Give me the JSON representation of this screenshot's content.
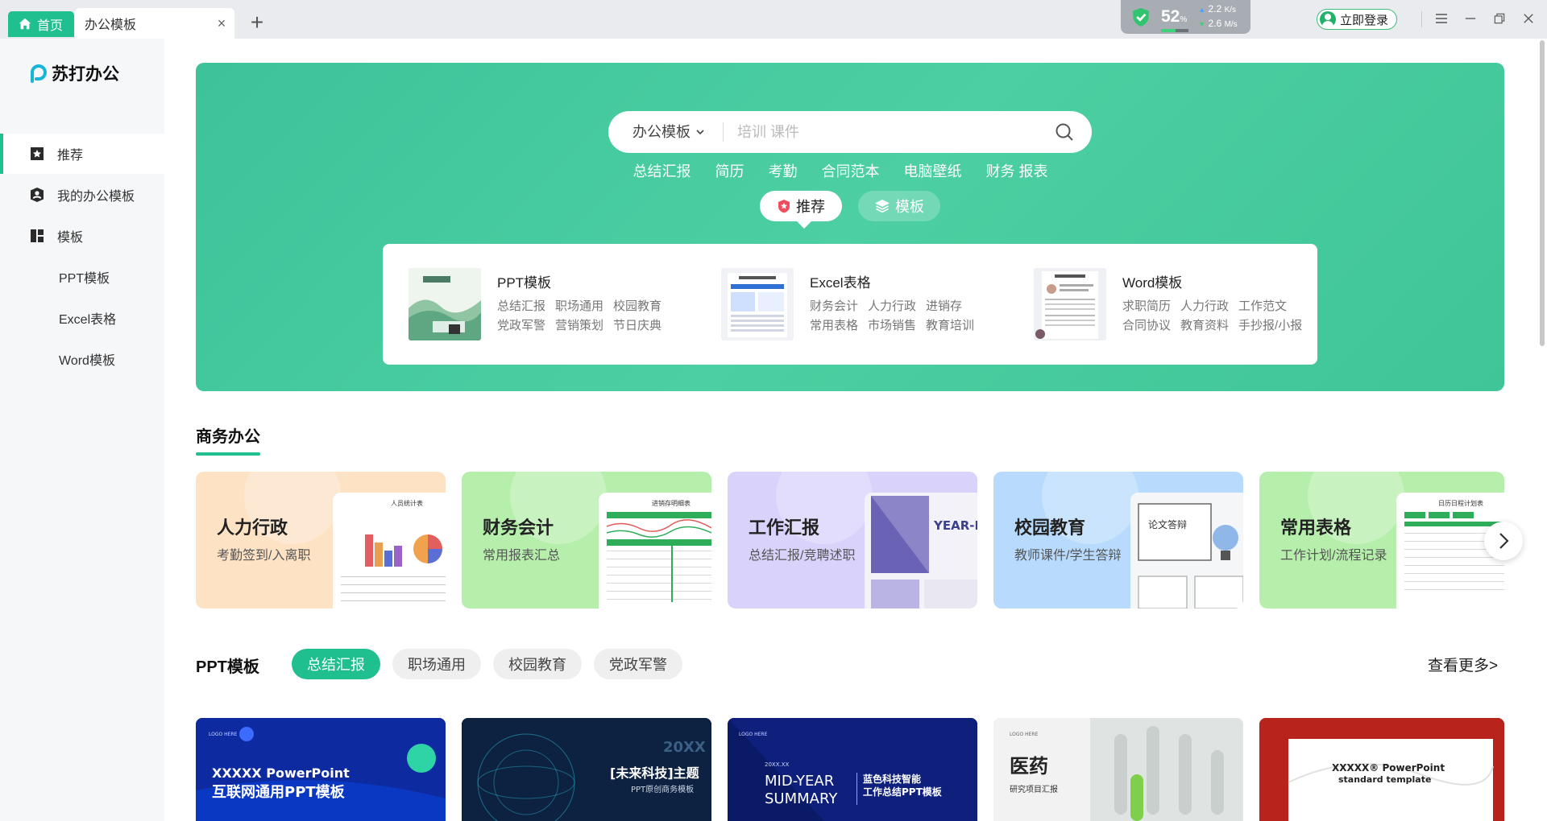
{
  "titlebar": {
    "home_tab": "首页",
    "active_tab": "办公模板",
    "close_glyph": "×",
    "add_glyph": "+",
    "network": {
      "percent": "52",
      "percent_unit": "%",
      "load_fraction": 0.52,
      "up_speed": "2.2",
      "down_speed": "2.6",
      "unit_up": "K/s",
      "unit_down": "M/s"
    },
    "login": "立即登录"
  },
  "sidebar": {
    "logo": "苏打办公",
    "items": [
      {
        "label": "推荐",
        "icon": "star-bookmark-icon"
      },
      {
        "label": "我的办公模板",
        "icon": "user-shield-icon"
      },
      {
        "label": "模板",
        "icon": "grid-layout-icon"
      },
      {
        "label": "PPT模板"
      },
      {
        "label": "Excel表格"
      },
      {
        "label": "Word模板"
      }
    ]
  },
  "hero": {
    "search": {
      "category": "办公模板",
      "placeholder": "培训 课件"
    },
    "hot_tags": [
      "总结汇报",
      "简历",
      "考勤",
      "合同范本",
      "电脑壁纸",
      "财务 报表"
    ],
    "pills": [
      {
        "label": "推荐"
      },
      {
        "label": "模板"
      }
    ],
    "panel": [
      {
        "title": "PPT模板",
        "links": [
          "总结汇报",
          "职场通用",
          "校园教育",
          "党政军警",
          "营销策划",
          "节日庆典"
        ]
      },
      {
        "title": "Excel表格",
        "links": [
          "财务会计",
          "人力行政",
          "进销存",
          "常用表格",
          "市场销售",
          "教育培训"
        ]
      },
      {
        "title": "Word模板",
        "links": [
          "求职简历",
          "人力行政",
          "工作范文",
          "合同协议",
          "教育资料",
          "手抄报/小报"
        ]
      }
    ]
  },
  "business": {
    "title": "商务办公",
    "cards": [
      {
        "name": "人力行政",
        "sub": "考勤签到/入离职",
        "color": "#fde2c4",
        "img_title": "人员统计表"
      },
      {
        "name": "财务会计",
        "sub": "常用报表汇总",
        "color": "#b6efac",
        "img_title": "进销存明细表"
      },
      {
        "name": "工作汇报",
        "sub": "总结汇报/竞聘述职",
        "color": "#d9d2fb",
        "img_title": "YEAR-END RE"
      },
      {
        "name": "校园教育",
        "sub": "教师课件/学生答辩",
        "color": "#b8dbfd",
        "img_title": "论文答辩"
      },
      {
        "name": "常用表格",
        "sub": "工作计划/流程记录",
        "color": "#b6efac",
        "img_title": "日历日程计划表"
      }
    ]
  },
  "ppt": {
    "title": "PPT模板",
    "tabs": [
      "总结汇报",
      "职场通用",
      "校园教育",
      "党政军警"
    ],
    "more": "查看更多>",
    "templates": [
      {
        "line1": "XXXXX PowerPoint",
        "line2": "互联网通用PPT模板",
        "logo": "LOGO HERE"
      },
      {
        "line1": "[未来科技]主题",
        "line2": "PPT原创商务模板",
        "year": "20XX"
      },
      {
        "line1": "MID-YEAR",
        "line2": "SUMMARY",
        "line3": "蓝色科技智能",
        "line4": "工作总结PPT模板",
        "logo": "LOGO HERE",
        "date": "20XX.XX"
      },
      {
        "line1": "医药",
        "line2": "研究项目汇报",
        "logo": "LOGO HERE"
      },
      {
        "line1": "XXXXX® PowerPoint",
        "line2": "standard template"
      }
    ]
  }
}
